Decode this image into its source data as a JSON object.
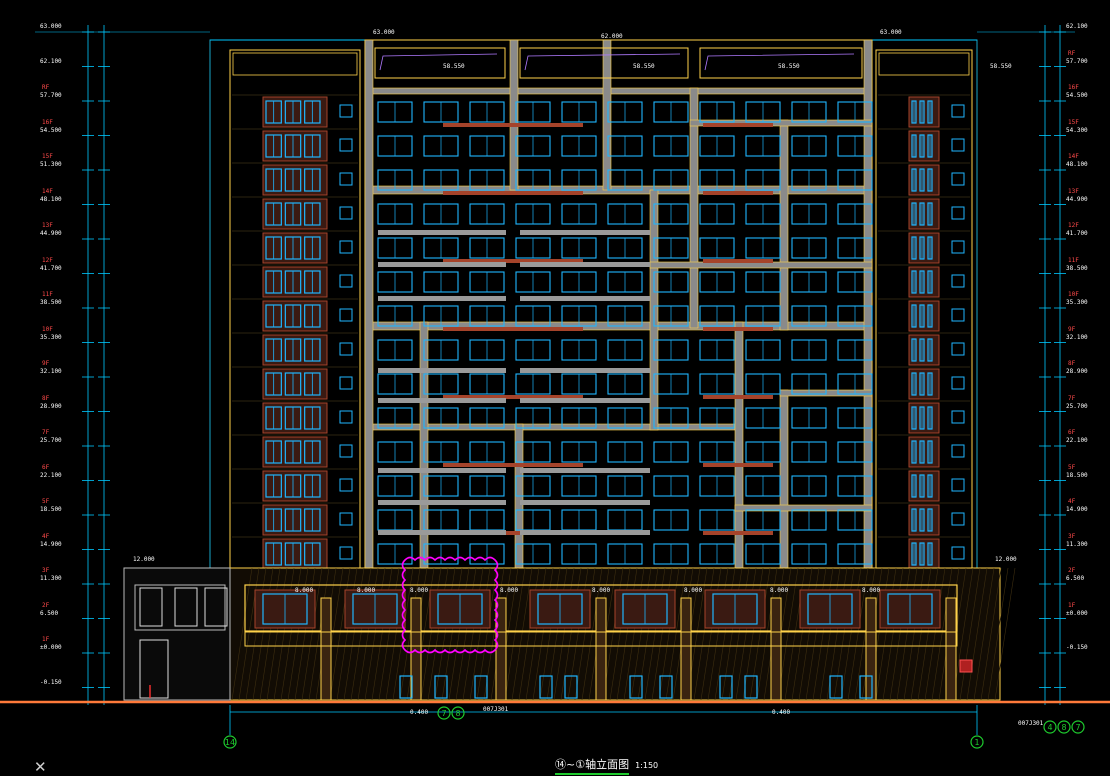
{
  "drawing": {
    "title": "⑭~①轴立面图",
    "scale": "1:150",
    "close_icon": "close-icon"
  },
  "colors": {
    "background": "#000000",
    "dimension_line": "#00c8ff",
    "grid_line": "#00c8ff",
    "level_text": "#ff4a4a",
    "elevation_text": "#ffffff",
    "facade_outline": "#ffd24a",
    "window_frame": "#1fb6ff",
    "brick_infill": "#a5432a",
    "gray_band": "#8a8a8a",
    "ground_line": "#ff7a3a",
    "revision_cloud": "#ff00ff",
    "axis_bubble": "#1ecb2e"
  },
  "levels_left": [
    {
      "name": "",
      "elev": "63.000"
    },
    {
      "name": "",
      "elev": "62.100"
    },
    {
      "name": "RF",
      "elev": "57.700"
    },
    {
      "name": "16F",
      "elev": "54.500"
    },
    {
      "name": "15F",
      "elev": "51.300"
    },
    {
      "name": "14F",
      "elev": "48.100"
    },
    {
      "name": "13F",
      "elev": "44.900"
    },
    {
      "name": "12F",
      "elev": "41.700"
    },
    {
      "name": "11F",
      "elev": "38.500"
    },
    {
      "name": "10F",
      "elev": "35.300"
    },
    {
      "name": "9F",
      "elev": "32.100"
    },
    {
      "name": "8F",
      "elev": "28.900"
    },
    {
      "name": "7F",
      "elev": "25.700"
    },
    {
      "name": "6F",
      "elev": "22.100"
    },
    {
      "name": "5F",
      "elev": "18.500"
    },
    {
      "name": "4F",
      "elev": "14.900"
    },
    {
      "name": "3F",
      "elev": "11.300"
    },
    {
      "name": "2F",
      "elev": "6.500"
    },
    {
      "name": "1F",
      "elev": "±0.000"
    },
    {
      "name": "",
      "elev": "-0.150"
    }
  ],
  "levels_right": [
    {
      "name": "",
      "elev": "62.100"
    },
    {
      "name": "RF",
      "elev": "57.700"
    },
    {
      "name": "16F",
      "elev": "54.500"
    },
    {
      "name": "15F",
      "elev": "54.300"
    },
    {
      "name": "14F",
      "elev": "48.100"
    },
    {
      "name": "13F",
      "elev": "44.900"
    },
    {
      "name": "12F",
      "elev": "41.700"
    },
    {
      "name": "11F",
      "elev": "38.500"
    },
    {
      "name": "10F",
      "elev": "35.300"
    },
    {
      "name": "9F",
      "elev": "32.100"
    },
    {
      "name": "8F",
      "elev": "28.900"
    },
    {
      "name": "7F",
      "elev": "25.700"
    },
    {
      "name": "6F",
      "elev": "22.100"
    },
    {
      "name": "5F",
      "elev": "18.500"
    },
    {
      "name": "4F",
      "elev": "14.900"
    },
    {
      "name": "3F",
      "elev": "11.300"
    },
    {
      "name": "2F",
      "elev": "6.500"
    },
    {
      "name": "1F",
      "elev": "±0.000"
    },
    {
      "name": "",
      "elev": "-0.150"
    }
  ],
  "podium": {
    "left_elev": "12.000",
    "right_elev": "12.000",
    "bay_elevs": [
      "8.000",
      "8.000",
      "8.000",
      "8.000",
      "8.000",
      "8.000",
      "8.000",
      "8.000"
    ],
    "ground_notes": [
      "0.400",
      "0.400"
    ]
  },
  "roof": {
    "elevs": [
      "63.000",
      "62.000",
      "63.000"
    ],
    "parapet_elevs": [
      "58.550",
      "58.550",
      "58.550",
      "58.550"
    ]
  },
  "axes": {
    "left": "14",
    "right": "1",
    "bubbles_left": [
      "7",
      "8"
    ],
    "bubbles_right": [
      "4",
      "8",
      "7"
    ],
    "note_left": "007J301",
    "note_right": "007J301"
  }
}
